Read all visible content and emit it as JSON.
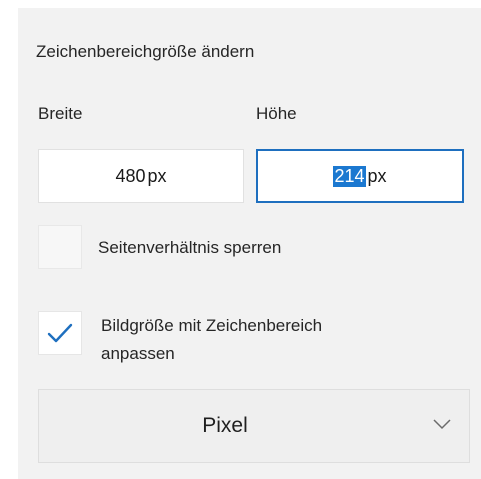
{
  "panel": {
    "title": "Zeichenbereichgröße ändern",
    "width_label": "Breite",
    "height_label": "Höhe",
    "width_value": "480",
    "width_unit": "px",
    "height_value": "214",
    "height_unit": "px"
  },
  "options": {
    "lock_aspect": {
      "label": "Seitenverhältnis sperren",
      "checked": false
    },
    "resize_image": {
      "label_line1": "Bildgröße mit Zeichenbereich",
      "label_line2": "anpassen",
      "checked": true
    }
  },
  "unit_select": {
    "value": "Pixel"
  },
  "colors": {
    "accent": "#1e6fbf",
    "selection": "#1b78d0",
    "panel_bg": "#f2f2f2"
  },
  "icons": {
    "checkmark": "checkmark-icon",
    "dropdown": "chevron-down-icon"
  }
}
